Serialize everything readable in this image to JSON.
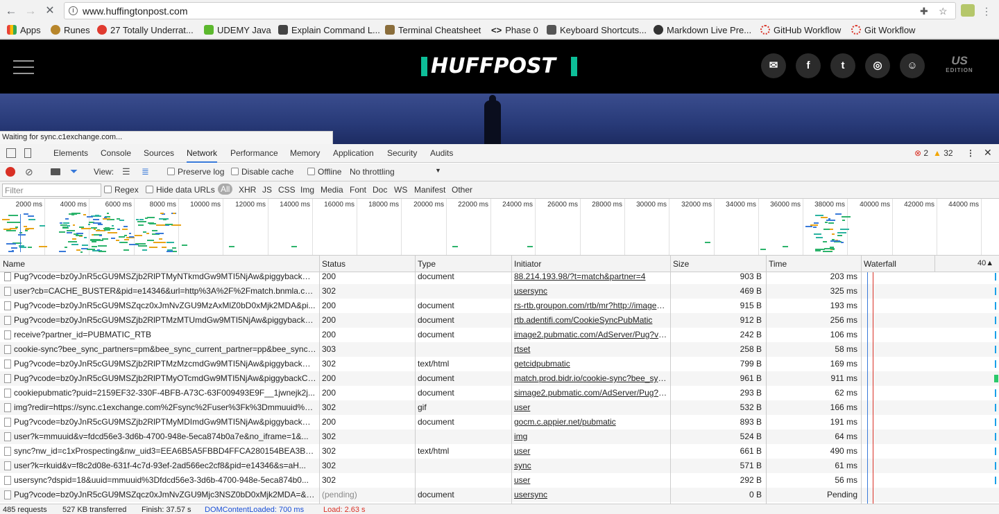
{
  "browser": {
    "url": "www.huffingtonpost.com",
    "bookmarks": [
      {
        "label": "Apps",
        "color": "#e94235"
      },
      {
        "label": "Runes",
        "color": "#b8862b"
      },
      {
        "label": "27 Totally Underrat...",
        "color": "#e03a2f"
      },
      {
        "label": "UDEMY Java",
        "color": "#5cb82e"
      },
      {
        "label": "Explain Command L...",
        "color": "#333333"
      },
      {
        "label": "Terminal Cheatsheet",
        "color": "#8a6d3b"
      },
      {
        "label": "Phase 0",
        "color": "#333333"
      },
      {
        "label": "Keyboard Shortcuts...",
        "color": "#555555"
      },
      {
        "label": "Markdown Live Pre...",
        "color": "#333333"
      },
      {
        "label": "GitHub Workflow",
        "color": "#d9362b"
      },
      {
        "label": "Git Workflow",
        "color": "#d9362b"
      }
    ]
  },
  "site": {
    "logo": "HUFFPOST",
    "edition_us": "US",
    "edition_label": "EDITION",
    "accent": "#0dbe98"
  },
  "status_popup": "Waiting for sync.c1exchange.com...",
  "devtools": {
    "tabs": [
      "Elements",
      "Console",
      "Sources",
      "Network",
      "Performance",
      "Memory",
      "Application",
      "Security",
      "Audits"
    ],
    "active_tab": "Network",
    "errors": "2",
    "warnings": "32",
    "view_label": "View:",
    "preserve_log": "Preserve log",
    "disable_cache": "Disable cache",
    "offline": "Offline",
    "throttling": "No throttling",
    "filter_placeholder": "Filter",
    "regex": "Regex",
    "hide_data_urls": "Hide data URLs",
    "type_filters": [
      "All",
      "XHR",
      "JS",
      "CSS",
      "Img",
      "Media",
      "Font",
      "Doc",
      "WS",
      "Manifest",
      "Other"
    ],
    "timeline_labels": [
      "2000 ms",
      "4000 ms",
      "6000 ms",
      "8000 ms",
      "10000 ms",
      "12000 ms",
      "14000 ms",
      "16000 ms",
      "18000 ms",
      "20000 ms",
      "22000 ms",
      "24000 ms",
      "26000 ms",
      "28000 ms",
      "30000 ms",
      "32000 ms",
      "34000 ms",
      "36000 ms",
      "38000 ms",
      "40000 ms",
      "42000 ms",
      "44000 ms",
      "4"
    ],
    "columns": {
      "name": "Name",
      "status": "Status",
      "type": "Type",
      "initiator": "Initiator",
      "size": "Size",
      "time": "Time",
      "waterfall": "Waterfall",
      "waterfall_scale": "40"
    },
    "rows": [
      {
        "name": "Pug?vcode=bz0yJnR5cGU9MSZjb2RlPTMyNTkmdGw9MTI5NjAw&piggybackCo...",
        "status": "200",
        "type": "document",
        "initiator": "88.214.193.98/?t=match&partner=4",
        "size": "903 B",
        "time": "203 ms"
      },
      {
        "name": "user?cb=CACHE_BUSTER&pid=e14346&url=http%3A%2F%2Fmatch.bnmla.com...",
        "status": "302",
        "type": "",
        "initiator": "usersync",
        "size": "469 B",
        "time": "325 ms"
      },
      {
        "name": "Pug?vcode=bz0yJnR5cGU9MSZqcz0xJmNvZGU9MzAxMlZ0bD0xMjk2MDA&pi...",
        "status": "200",
        "type": "document",
        "initiator": "rs-rtb.groupon.com/rtb/mr?http://image2...",
        "size": "915 B",
        "time": "193 ms"
      },
      {
        "name": "Pug?vcode=bz0yJnR5cGU9MSZjb2RlPTMzMTUmdGw9MTI5NjAw&piggybackC...",
        "status": "200",
        "type": "document",
        "initiator": "rtb.adentifi.com/CookieSyncPubMatic",
        "size": "912 B",
        "time": "256 ms"
      },
      {
        "name": "receive?partner_id=PUBMATIC_RTB",
        "status": "200",
        "type": "document",
        "initiator": "image2.pubmatic.com/AdServer/Pug?vc...",
        "size": "242 B",
        "time": "106 ms"
      },
      {
        "name": "cookie-sync?bee_sync_partners=pm&bee_sync_current_partner=pp&bee_sync_in...",
        "status": "303",
        "type": "",
        "initiator": "rtset",
        "size": "258 B",
        "time": "58 ms"
      },
      {
        "name": "Pug?vcode=bz0yJnR5cGU9MSZjb2RlPTMzMzcmdGw9MTI5NjAw&piggybackCo...",
        "status": "302",
        "type": "text/html",
        "initiator": "getcidpubmatic",
        "size": "799 B",
        "time": "169 ms"
      },
      {
        "name": "Pug?vcode=bz0yJnR5cGU9MSZjb2RlPTMyOTcmdGw9MTI5NjAw&piggybackCo...",
        "status": "200",
        "type": "document",
        "initiator": "match.prod.bidr.io/cookie-sync?bee_syn...",
        "size": "961 B",
        "time": "911 ms"
      },
      {
        "name": "cookiepubmatic?puid=2159EF32-330F-4BFB-A73C-63F009493E9F__1jwnejk2j...",
        "status": "200",
        "type": "document",
        "initiator": "simage2.pubmatic.com/AdServer/Pug?v...",
        "size": "293 B",
        "time": "62 ms"
      },
      {
        "name": "img?redir=https://sync.c1exchange.com%2Fsync%2Fuser%3Fk%3Dmmuuid%26v...",
        "status": "302",
        "type": "gif",
        "initiator": "user",
        "size": "532 B",
        "time": "166 ms"
      },
      {
        "name": "Pug?vcode=bz0yJnR5cGU9MSZjb2RlPTMyMDImdGw9MTI5NjAw&piggybackCo...",
        "status": "200",
        "type": "document",
        "initiator": "gocm.c.appier.net/pubmatic",
        "size": "893 B",
        "time": "191 ms"
      },
      {
        "name": "user?k=mmuuid&v=fdcd56e3-3d6b-4700-948e-5eca874b0a7e&no_iframe=1&...",
        "status": "302",
        "type": "",
        "initiator": "img",
        "size": "524 B",
        "time": "64 ms"
      },
      {
        "name": "sync?nw_id=c1xProspecting&nw_uid3=EEA6B5A5FBBD4FFCA280154BEA3BBC...",
        "status": "302",
        "type": "text/html",
        "initiator": "user",
        "size": "661 B",
        "time": "490 ms"
      },
      {
        "name": "user?k=rkuid&v=f8c2d08e-631f-4c7d-93ef-2ad566ec2cf8&pid=e14346&s=aH...",
        "status": "302",
        "type": "",
        "initiator": "sync",
        "size": "571 B",
        "time": "61 ms"
      },
      {
        "name": "usersync?dspid=18&uuid=mmuuid%3Dfdcd56e3-3d6b-4700-948e-5eca874b0...",
        "status": "302",
        "type": "",
        "initiator": "user",
        "size": "292 B",
        "time": "56 ms"
      },
      {
        "name": "Pug?vcode=bz0yJnR5cGU9MSZqcz0xJmNvZGU9Mjc3NSZ0bD0xMjk2MDA=&p...",
        "status": "(pending)",
        "type": "document",
        "initiator": "usersync",
        "size": "0 B",
        "time": "Pending"
      }
    ],
    "statusbar": {
      "requests": "485 requests",
      "transferred": "527 KB transferred",
      "finish": "Finish: 37.57 s",
      "dcl": "DOMContentLoaded: 700 ms",
      "load": "Load: 2.63 s"
    }
  }
}
